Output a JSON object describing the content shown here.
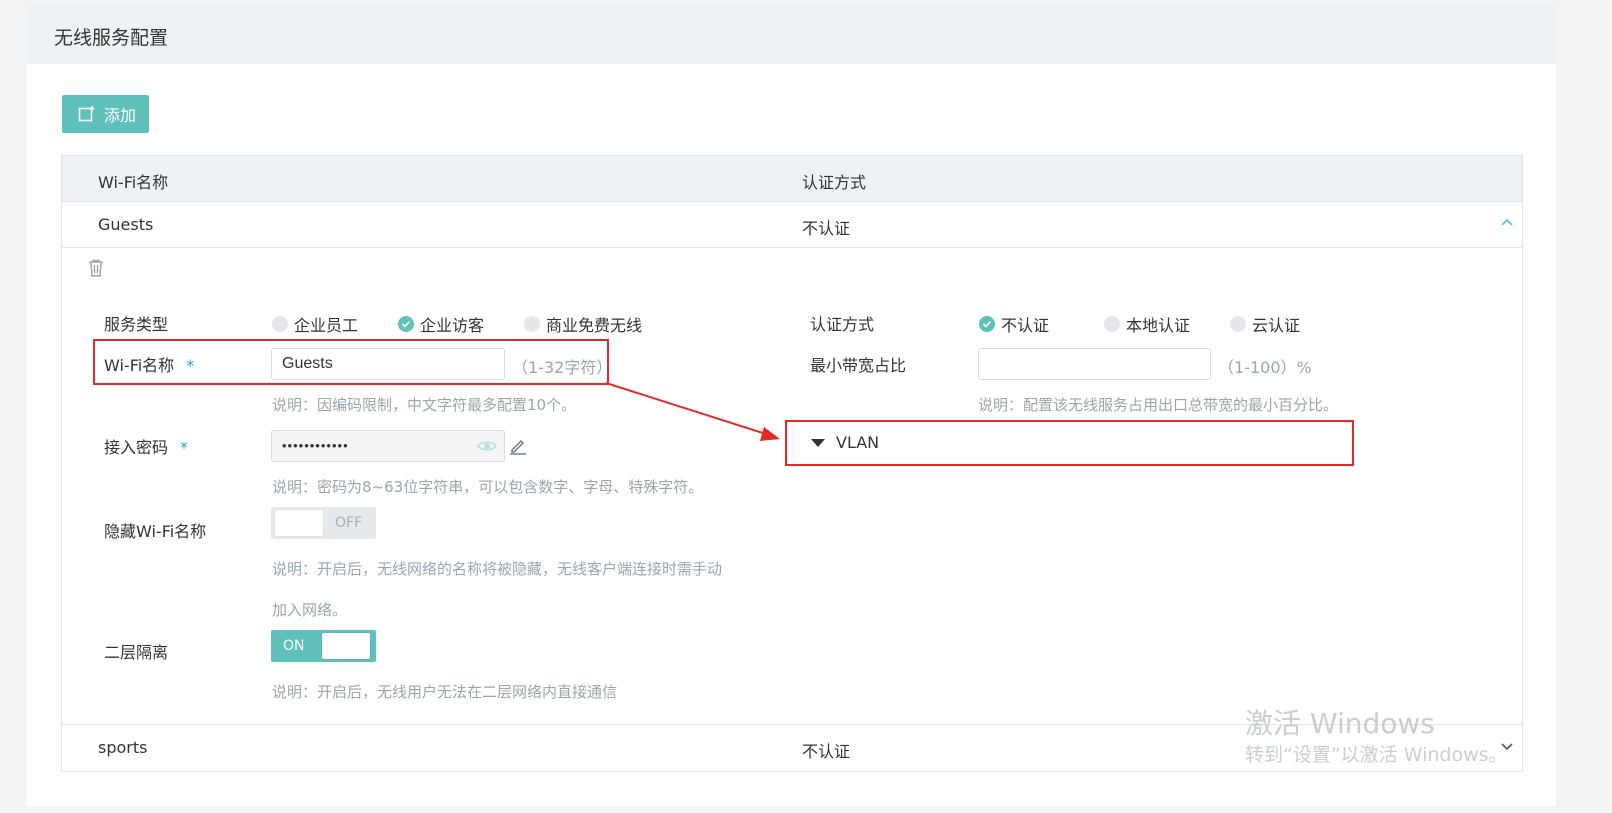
{
  "panel": {
    "title": "无线服务配置"
  },
  "toolbar": {
    "add_label": "添加"
  },
  "table": {
    "headers": {
      "name": "Wi-Fi名称",
      "auth": "认证方式"
    },
    "rows": [
      {
        "name": "Guests",
        "auth": "不认证"
      },
      {
        "name": "sports",
        "auth": "不认证"
      }
    ]
  },
  "form": {
    "service_type": {
      "label": "服务类型",
      "options": [
        "企业员工",
        "企业访客",
        "商业免费无线"
      ],
      "selected": "企业访客"
    },
    "ssid": {
      "label": "Wi-Fi名称",
      "required_mark": "*",
      "value": "Guests",
      "range": "（1-32字符）",
      "hint": "说明：因编码限制，中文字符最多配置10个。"
    },
    "password": {
      "label": "接入密码",
      "required_mark": "*",
      "value": "••••••••••••",
      "hint": "说明：密码为8~63位字符串，可以包含数字、字母、特殊字符。"
    },
    "hide_ssid": {
      "label": "隐藏Wi-Fi名称",
      "state": "OFF",
      "hint_line1": "说明：开启后，无线网络的名称将被隐藏，无线客户端连接时需手动",
      "hint_line2": "加入网络。"
    },
    "isolation": {
      "label": "二层隔离",
      "state": "ON",
      "hint": "说明：开启后，无线用户无法在二层网络内直接通信"
    },
    "auth_mode": {
      "label": "认证方式",
      "options": [
        "不认证",
        "本地认证",
        "云认证"
      ],
      "selected": "不认证"
    },
    "min_bandwidth": {
      "label": "最小带宽占比",
      "value": "",
      "range": "（1-100）%",
      "hint": "说明：配置该无线服务占用出口总带宽的最小百分比。"
    },
    "vlan": {
      "label": "VLAN"
    }
  },
  "watermark": {
    "line1": "激活 Windows",
    "line2": "转到“设置”以激活 Windows。"
  },
  "colors": {
    "accent": "#5fc0bc",
    "annotation": "#e62828",
    "required": "#32a0c8"
  }
}
